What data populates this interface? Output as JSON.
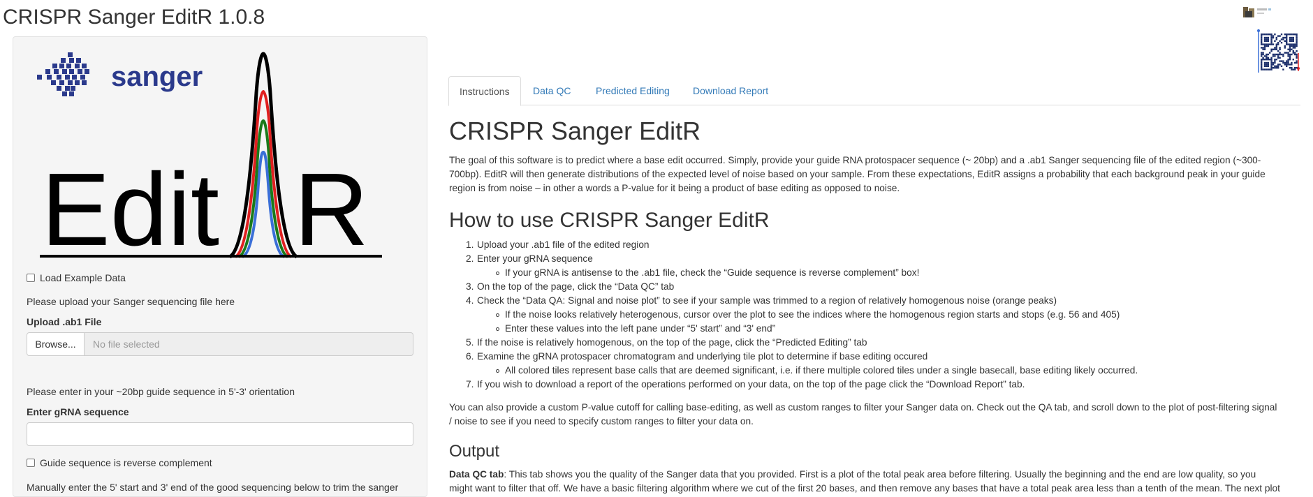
{
  "app": {
    "title": "CRISPR Sanger EditR 1.0.8"
  },
  "sidebar": {
    "logo": {
      "brand_text": "sanger",
      "big_text_left": "Edit",
      "big_text_right": "R"
    },
    "load_example_label": "Load Example Data",
    "upload_help": "Please upload your Sanger sequencing file here",
    "upload_label": "Upload .ab1 File",
    "browse_label": "Browse...",
    "file_placeholder": "No file selected",
    "guide_help": "Please enter in your ~20bp guide sequence in 5'-3' orientation",
    "grna_label": "Enter gRNA sequence",
    "grna_value": "",
    "reverse_complement_label": "Guide sequence is reverse complement",
    "trim_help": "Manually enter the 5' start and 3' end of the good sequencing below to trim the sanger"
  },
  "tabs": [
    {
      "label": "Instructions",
      "active": true
    },
    {
      "label": "Data QC",
      "active": false
    },
    {
      "label": "Predicted Editing",
      "active": false
    },
    {
      "label": "Download Report",
      "active": false
    }
  ],
  "main": {
    "title": "CRISPR Sanger EditR",
    "intro_lines": [
      "The goal of this software is to predict where a base edit occurred. Simply, provide your guide RNA protospacer sequence (~ 20bp) and a .ab1 Sanger sequencing file of the edited region (~300-",
      "700bp). EditR will then generate distributions of the expected level of noise based on your sample. From these expectations, EditR assigns a probability that each background peak in your guide",
      "region is from noise – in other a words a P-value for it being a product of base editing as opposed to noise."
    ],
    "howto_title": "How to use CRISPR Sanger EditR",
    "steps": [
      {
        "num": "1.",
        "text": "Upload your .ab1 file of the edited region",
        "subs": []
      },
      {
        "num": "2.",
        "text": "Enter your gRNA sequence",
        "subs": [
          "If your gRNA is antisense to the .ab1 file, check the “Guide sequence is reverse complement” box!"
        ]
      },
      {
        "num": "3.",
        "text": "On the top of the page, click the “Data QC” tab",
        "subs": []
      },
      {
        "num": "4.",
        "text": "Check the “Data QA: Signal and noise plot” to see if your sample was trimmed to a region of relatively homogenous noise (orange peaks)",
        "subs": [
          "If the noise looks relatively heterogenous, cursor over the plot to see the indices where the homogenous region starts and stops (e.g. 56 and 405)",
          "Enter these values into the left pane under “5' start” and “3' end”"
        ]
      },
      {
        "num": "5.",
        "text": "If the noise is relatively homogenous, on the top of the page, click the “Predicted Editing” tab",
        "subs": []
      },
      {
        "num": "6.",
        "text": "Examine the gRNA protospacer chromatogram and underlying tile plot to determine if base editing occured",
        "subs": [
          "All colored tiles represent base calls that are deemed significant, i.e. if there multiple colored tiles under a single basecall, base editing likely occurred."
        ]
      },
      {
        "num": "7.",
        "text": "If you wish to download a report of the operations performed on your data, on the top of the page click the “Download Report” tab.",
        "subs": []
      }
    ],
    "custom_lines": [
      "You can also provide a custom P-value cutoff for calling base-editing, as well as custom ranges to filter your Sanger data on. Check out the QA tab, and scroll down to the plot of post-filtering signal",
      "/ noise to see if you need to specify custom ranges to filter your data on."
    ],
    "output_title": "Output",
    "dataqc_label": "Data QC tab",
    "dataqc_lines": [
      ": This tab shows you the quality of the Sanger data that you provided. First is a plot of the total peak area before filtering. Usually the beginning and the end are low quality, so you",
      "might want to filter that off. We have a basic filtering algorithm where we cut of the first 20 bases, and then remove any bases that have a total peak area less than a tenth of the mean. The next plot"
    ]
  },
  "colors": {
    "link": "#337ab7",
    "sanger_blue": "#2b3a8c",
    "peak_red": "#e02020",
    "peak_green": "#1a7a1a",
    "peak_blue": "#3a6fd8"
  }
}
